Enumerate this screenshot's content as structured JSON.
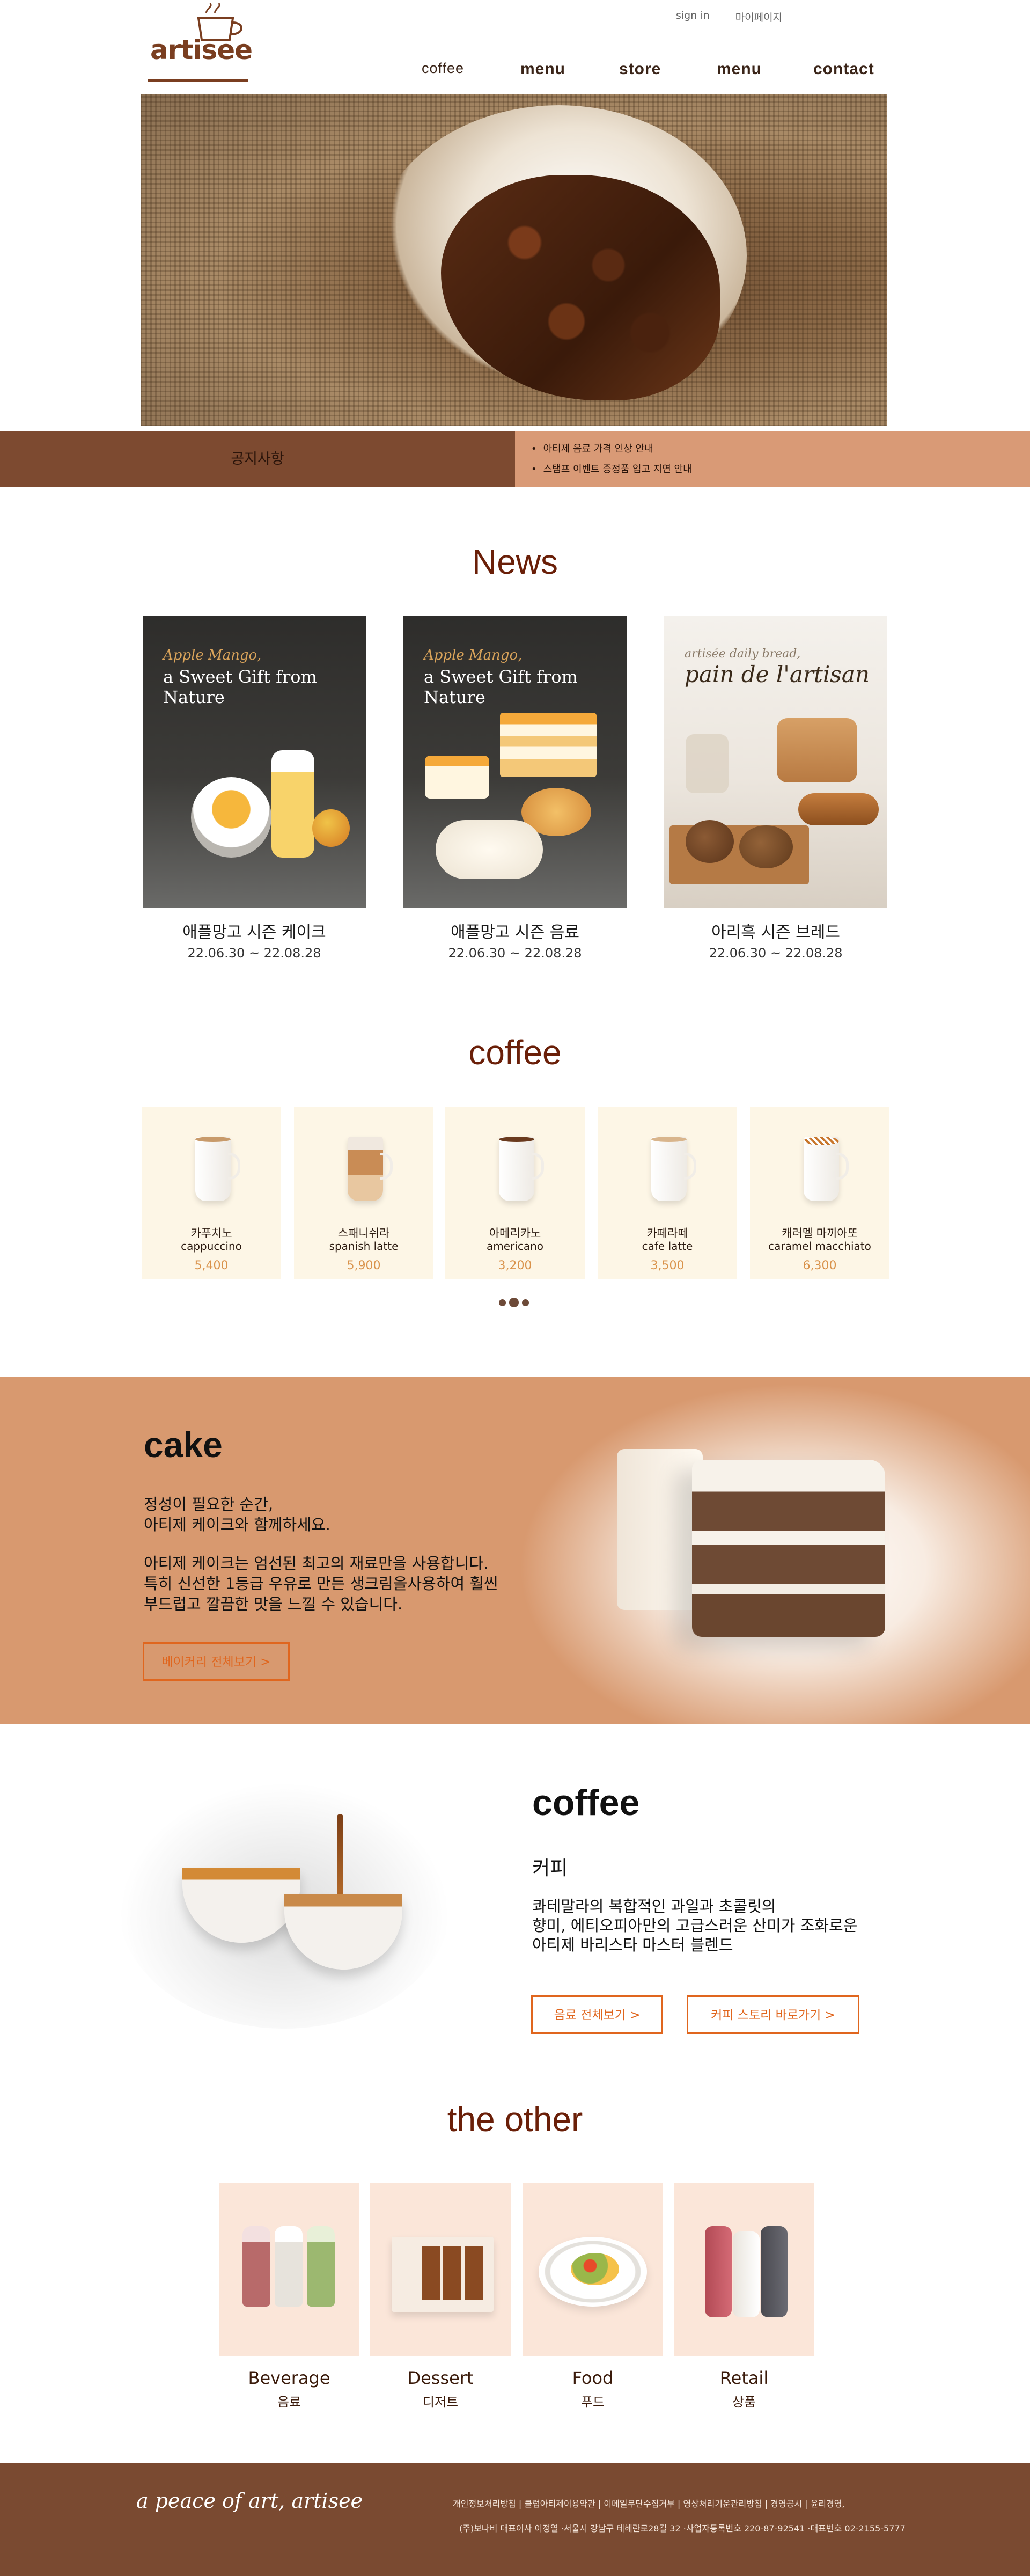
{
  "header": {
    "logo_text": "artisee",
    "top_links": [
      "sign in",
      "마이페이지"
    ],
    "nav": [
      "coffee",
      "menu",
      "store",
      "menu",
      "contact"
    ]
  },
  "notice": {
    "title": "공지사항",
    "items": [
      "아티제 음료 가격 인상 안내",
      "스탬프 이벤트 증정품 입고 지연 안내"
    ]
  },
  "news": {
    "title": "News",
    "items": [
      {
        "caption_line1": "Apple Mango,",
        "caption_line2": "a Sweet Gift from Nature",
        "name": "애플망고 시즌 케이크",
        "date": "22.06.30 ~ 22.08.28"
      },
      {
        "caption_line1": "Apple Mango,",
        "caption_line2": "a Sweet Gift from Nature",
        "name": "애플망고 시즌 음료",
        "date": "22.06.30 ~ 22.08.28"
      },
      {
        "caption_line1": "artisée daily bread,",
        "caption_line2": "pain de l'artisan",
        "name": "아리흑 시즌 브레드",
        "date": "22.06.30 ~ 22.08.28"
      }
    ]
  },
  "coffee_menu": {
    "title": "coffee",
    "items": [
      {
        "ko": "카푸치노",
        "en": "cappuccino",
        "price": "5,400"
      },
      {
        "ko": "스패니쉬라",
        "en": "spanish latte",
        "price": "5,900"
      },
      {
        "ko": "아메리카노",
        "en": "americano",
        "price": "3,200"
      },
      {
        "ko": "카페라떼",
        "en": "cafe latte",
        "price": "3,500"
      },
      {
        "ko": "캐러멜 마끼아또",
        "en": "caramel macchiato",
        "price": "6,300"
      }
    ],
    "carousel_pages": 3,
    "active_page": 2
  },
  "cake": {
    "title": "cake",
    "lines": [
      "정성이 필요한 순간,",
      "아티제 케이크와 함께하세요.",
      "아티제 케이크는 엄선된 최고의 재료만을 사용합니다.",
      "특히 신선한 1등급 우유로 만든 생크림을사용하여 훨씬",
      "부드럽고 깔끔한 맛을 느낄 수 있습니다."
    ],
    "button": "베이커리 전체보기 >"
  },
  "coffee_promo": {
    "title": "coffee",
    "subtitle": "커피",
    "lines": [
      "콰테말라의 복합적인 과일과 초콜릿의",
      "향미, 에티오피아만의 고급스러운 산미가 조화로운",
      "아티제 바리스타 마스터 블렌드"
    ],
    "buttons": [
      "음료 전체보기 >",
      "커피 스토리 바로가기 >"
    ]
  },
  "the_other": {
    "title": "the other",
    "items": [
      {
        "en": "Beverage",
        "ko": "음료"
      },
      {
        "en": "Dessert",
        "ko": "디저트"
      },
      {
        "en": "Food",
        "ko": "푸드"
      },
      {
        "en": "Retail",
        "ko": "상품"
      }
    ]
  },
  "footer": {
    "slogan": "a peace of art, artisee",
    "line1": "개인정보처리방침 | 클럽아티제이용약관 | 이메일무단수집거부 | 영상처리기운관리방침 | 경영공시 | 윤리경영,",
    "line2": "(주)보나비 대표이사 이정열 ·서울시 강남구 테헤란로28길 32 ·사업자등록번호 220-87-92541 ·대표번호 02-2155-5777"
  },
  "colors": {
    "brand_brown": "#7a4a31",
    "accent_peach": "#d8996f",
    "accent_orange": "#e0661e",
    "title_red_brown": "#6a1f08"
  }
}
